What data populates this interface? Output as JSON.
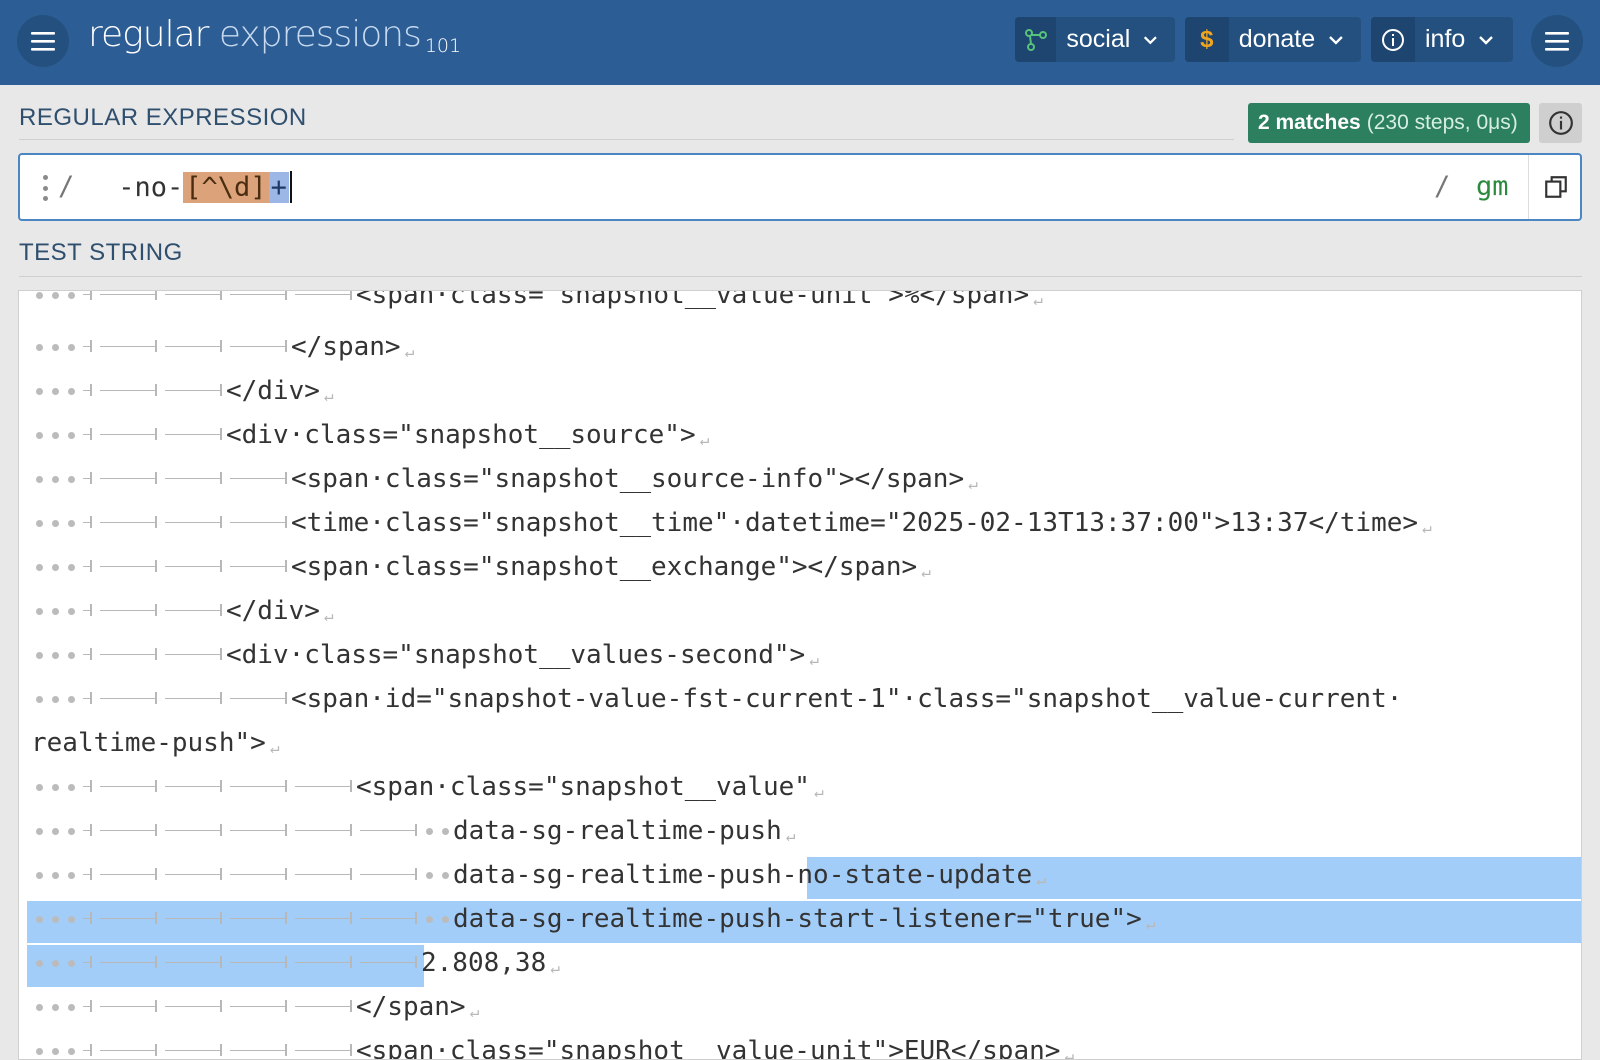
{
  "header": {
    "logo_regular": "regular",
    "logo_expressions": " expressions",
    "logo_version": "101",
    "social_label": "social",
    "donate_label": "donate",
    "info_label": "info",
    "donate_symbol": "$"
  },
  "regex_section": {
    "title": "REGULAR EXPRESSION",
    "matches_bold": "2 matches",
    "matches_detail": "(230 steps, 0μs)",
    "open_delim": "/",
    "pattern_plain": " -no-",
    "pattern_class": "[^\\d]",
    "pattern_quant": "+",
    "close_delim": "/",
    "flags": "gm"
  },
  "test_section": {
    "title": "TEST STRING",
    "lines": [
      "<span·class=\"snapshot__value-unit\">%</span>",
      "</span>",
      "</div>",
      "<div·class=\"snapshot__source\">",
      "<span·class=\"snapshot__source-info\"></span>",
      "<time·class=\"snapshot__time\"·datetime=\"2025-02-13T13:37:00\">13:37</time>",
      "<span·class=\"snapshot__exchange\"></span>",
      "</div>",
      "<div·class=\"snapshot__values-second\">",
      "<span·id=\"snapshot-value-fst-current-1\"·class=\"snapshot__value-current·",
      "realtime-push\">",
      "<span·class=\"snapshot__value\"",
      "data-sg-realtime-push",
      "data-sg-realtime-push",
      "-no-state-update",
      "data-sg-realtime-push-start-listener=\"true\">",
      "2.808,38",
      "</span>",
      "<span·class=\"snapshot__value-unit\">EUR</span>"
    ]
  },
  "colors": {
    "header_bg": "#2c5d94",
    "match_badge": "#2c8060",
    "match_highlight": "#a3cdf9",
    "char_class": "#dca37b",
    "quantifier": "#9cb6e6",
    "flags": "#2b8a3e"
  },
  "icons": [
    "menu-icon",
    "social-graph-icon",
    "dollar-icon",
    "info-circle-icon",
    "chevron-down-icon",
    "copy-icon"
  ]
}
